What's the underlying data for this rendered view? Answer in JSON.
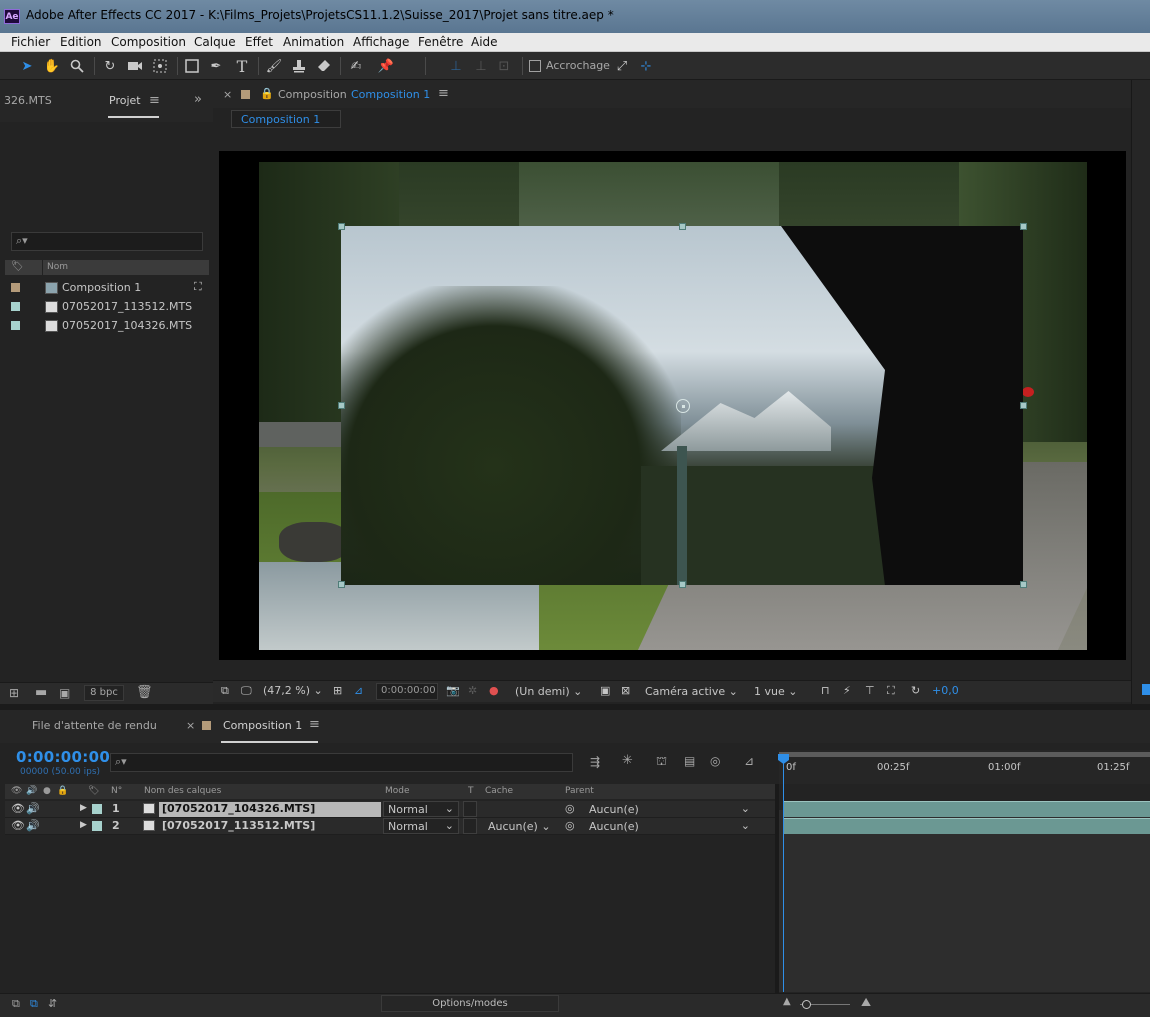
{
  "window": {
    "app_icon": "Ae",
    "title": "Adobe After Effects CC 2017 - K:\\Films_Projets\\ProjetsCS11.1.2\\Suisse_2017\\Projet sans titre.aep *"
  },
  "menu": [
    "Fichier",
    "Edition",
    "Composition",
    "Calque",
    "Effet",
    "Animation",
    "Affichage",
    "Fenêtre",
    "Aide"
  ],
  "toolbar": {
    "snapping_label": "Accrochage",
    "active_tool": "selection-tool"
  },
  "project": {
    "left_tab": "326.MTS",
    "tab": "Projet",
    "columns": {
      "name": "Nom"
    },
    "items": [
      {
        "name": "Composition 1",
        "label_color": "#b49b7a",
        "type": "composition"
      },
      {
        "name": "07052017_113512.MTS",
        "label_color": "#a7d2cd",
        "type": "footage"
      },
      {
        "name": "07052017_104326.MTS",
        "label_color": "#a7d2cd",
        "type": "footage"
      }
    ],
    "bit_depth": "8 bpc"
  },
  "viewer": {
    "tab_prefix": "Composition",
    "tab_name": "Composition 1",
    "breadcrumb": "Composition 1",
    "zoom": "(47,2 %)",
    "timecode": "0:00:00:00",
    "resolution": "(Un demi)",
    "camera": "Caméra active",
    "views": "1 vue",
    "exposure": "+0,0"
  },
  "timeline": {
    "render_queue_tab": "File d'attente de rendu",
    "comp_tab": "Composition 1",
    "timecode": "0:00:00:00",
    "fps": "00000 (50.00 ips)",
    "columns": {
      "number": "N°",
      "layer_name": "Nom des calques",
      "mode": "Mode",
      "t": "T",
      "matte": "Cache",
      "parent": "Parent"
    },
    "layers": [
      {
        "num": "1",
        "name": "[07052017_104326.MTS]",
        "mode": "Normal",
        "matte": "",
        "parent": "Aucun(e)",
        "color": "#a7d2cd",
        "selected": true
      },
      {
        "num": "2",
        "name": "[07052017_113512.MTS]",
        "mode": "Normal",
        "matte": "Aucun(e)",
        "parent": "Aucun(e)",
        "color": "#a7d2cd",
        "selected": false
      }
    ],
    "ruler_labels": [
      "0f",
      "00:25f",
      "01:00f",
      "01:25f"
    ],
    "options_label": "Options/modes"
  },
  "colors": {
    "accent": "#2f8fe8",
    "panel": "#232323",
    "layer_track": "#6b9893"
  }
}
